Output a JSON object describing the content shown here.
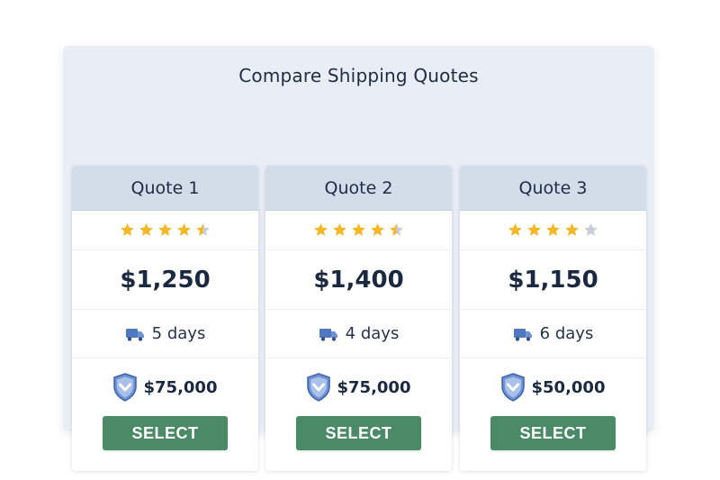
{
  "title": "Compare Shipping Quotes",
  "colors": {
    "panel_bg": "#e9edf5",
    "card_header_bg": "#d3ddea",
    "star_gold": "#f4b728",
    "star_empty": "#c9ced6",
    "button_green": "#4a8a67",
    "icon_blue": "#4f78c0"
  },
  "quotes": [
    {
      "name": "Quote 1",
      "rating": 4.5,
      "price": "$1,250",
      "delivery": "5 days",
      "insurance": "$75,000",
      "button_label": "SELECT"
    },
    {
      "name": "Quote 2",
      "rating": 4.5,
      "price": "$1,400",
      "delivery": "4 days",
      "insurance": "$75,000",
      "button_label": "SELECT"
    },
    {
      "name": "Quote 3",
      "rating": 4,
      "price": "$1,150",
      "delivery": "6 days",
      "insurance": "$50,000",
      "button_label": "SELECT"
    }
  ],
  "icons": {
    "delivery": "truck-icon",
    "insurance": "shield-icon",
    "rating": "star-icon"
  }
}
